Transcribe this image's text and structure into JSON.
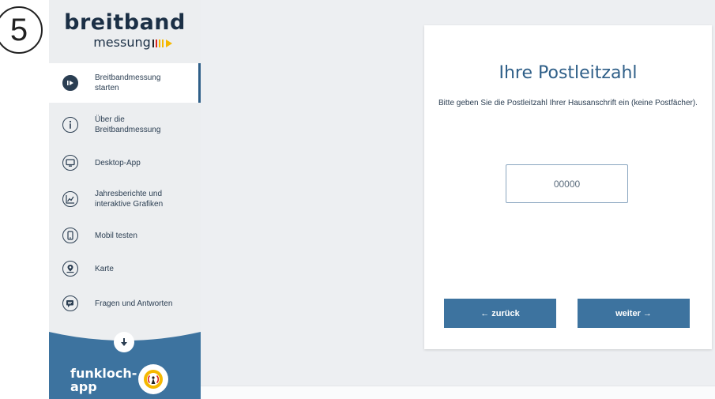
{
  "step": {
    "number": "5"
  },
  "logo": {
    "main": "breitband",
    "sub": "messung",
    "bar_colors": [
      "#222222",
      "#d9231c",
      "#f5b800",
      "#f5b800"
    ]
  },
  "sidebar": {
    "items": [
      {
        "label": "Breitbandmessung starten",
        "icon": "play-icon",
        "active": true
      },
      {
        "label": "Über die Breitbandmessung",
        "icon": "info-icon",
        "active": false
      },
      {
        "label": "Desktop-App",
        "icon": "monitor-icon",
        "active": false
      },
      {
        "label": "Jahresberichte und interaktive Grafiken",
        "icon": "chart-icon",
        "active": false
      },
      {
        "label": "Mobil testen",
        "icon": "smartphone-icon",
        "active": false
      },
      {
        "label": "Karte",
        "icon": "map-pin-icon",
        "active": false
      },
      {
        "label": "Fragen und Antworten",
        "icon": "chat-icon",
        "active": false
      }
    ]
  },
  "promo": {
    "text_line1": "funkloch-",
    "text_line2": "app",
    "bg_color": "#3d739f"
  },
  "card": {
    "title": "Ihre Postleitzahl",
    "description": "Bitte geben Sie die Postleitzahl Ihrer Hausanschrift ein (keine Postfächer).",
    "input_placeholder": "00000",
    "input_value": "",
    "back_label": "← zurück",
    "next_label": "weiter →"
  },
  "colors": {
    "primary": "#3d739f",
    "title": "#2f5f88",
    "text": "#2b3e52",
    "accent_yellow": "#f5b800"
  }
}
